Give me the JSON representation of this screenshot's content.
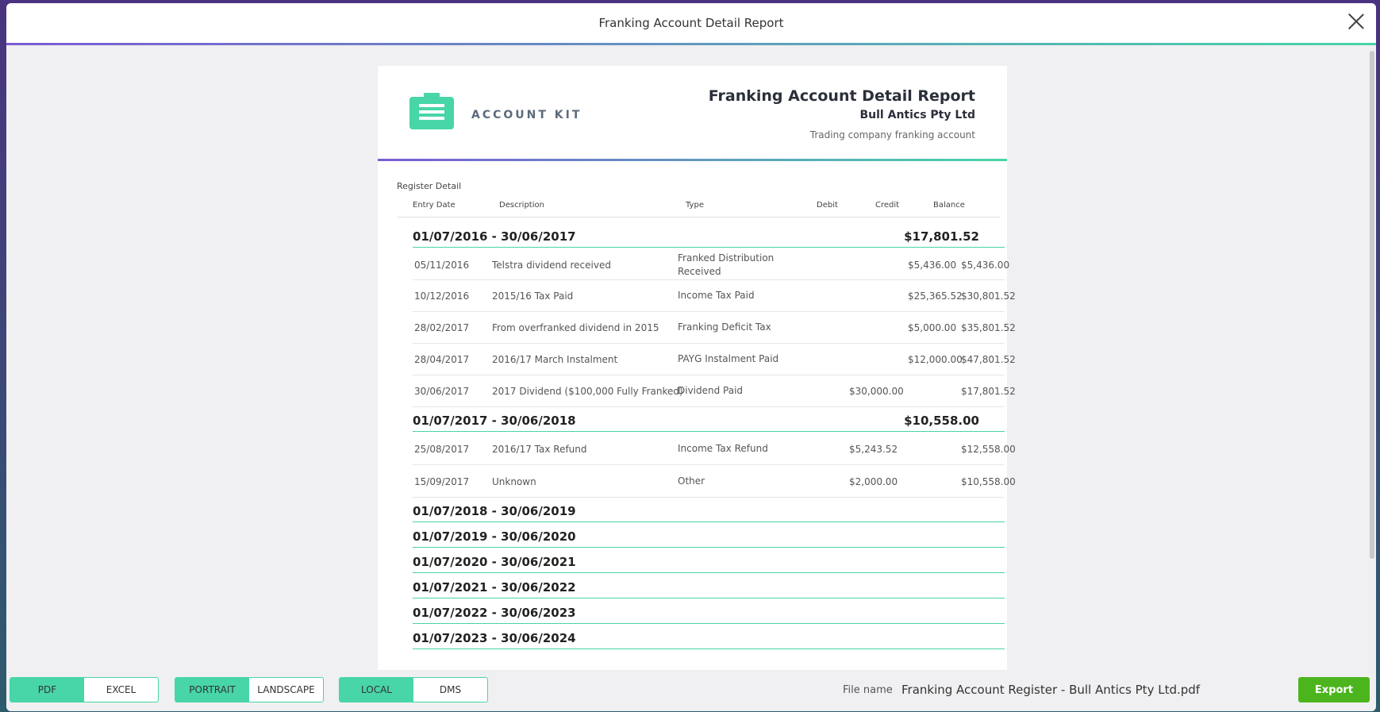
{
  "modal": {
    "title": "Franking Account Detail Report"
  },
  "report": {
    "logo_text": "ACCOUNT KIT",
    "title": "Franking Account Detail Report",
    "company": "Bull Antics Pty Ltd",
    "subtitle": "Trading company franking account",
    "section_title": "Register Detail",
    "columns": {
      "entry_date": "Entry Date",
      "description": "Description",
      "type": "Type",
      "debit": "Debit",
      "credit": "Credit",
      "balance": "Balance"
    },
    "periods": [
      {
        "label": "01/07/2016 - 30/06/2017",
        "balance": "$17,801.52",
        "rows": [
          {
            "date": "05/11/2016",
            "desc": "Telstra dividend received",
            "type": "Franked Distribution Received",
            "debit": "",
            "credit": "$5,436.00",
            "balance": "$5,436.00"
          },
          {
            "date": "10/12/2016",
            "desc": "2015/16 Tax Paid",
            "type": "Income Tax Paid",
            "debit": "",
            "credit": "$25,365.52",
            "balance": "$30,801.52"
          },
          {
            "date": "28/02/2017",
            "desc": "From overfranked dividend in 2015",
            "type": "Franking Deficit Tax",
            "debit": "",
            "credit": "$5,000.00",
            "balance": "$35,801.52"
          },
          {
            "date": "28/04/2017",
            "desc": "2016/17 March Instalment",
            "type": "PAYG Instalment Paid",
            "debit": "",
            "credit": "$12,000.00",
            "balance": "$47,801.52"
          },
          {
            "date": "30/06/2017",
            "desc": "2017 Dividend ($100,000 Fully Franked)",
            "type": "Dividend Paid",
            "debit": "$30,000.00",
            "credit": "",
            "balance": "$17,801.52"
          }
        ]
      },
      {
        "label": "01/07/2017 - 30/06/2018",
        "balance": "$10,558.00",
        "rows": [
          {
            "date": "25/08/2017",
            "desc": "2016/17 Tax Refund",
            "type": "Income Tax Refund",
            "debit": "$5,243.52",
            "credit": "",
            "balance": "$12,558.00"
          },
          {
            "date": "15/09/2017",
            "desc": "Unknown",
            "type": "Other",
            "debit": "$2,000.00",
            "credit": "",
            "balance": "$10,558.00"
          }
        ]
      },
      {
        "label": "01/07/2018 - 30/06/2019",
        "balance": "",
        "rows": []
      },
      {
        "label": "01/07/2019 - 30/06/2020",
        "balance": "",
        "rows": []
      },
      {
        "label": "01/07/2020 - 30/06/2021",
        "balance": "",
        "rows": []
      },
      {
        "label": "01/07/2021 - 30/06/2022",
        "balance": "",
        "rows": []
      },
      {
        "label": "01/07/2022 - 30/06/2023",
        "balance": "",
        "rows": []
      },
      {
        "label": "01/07/2023 - 30/06/2024",
        "balance": "",
        "rows": []
      }
    ]
  },
  "footer": {
    "format": {
      "pdf": "PDF",
      "excel": "EXCEL",
      "selected": "pdf"
    },
    "orientation": {
      "portrait": "PORTRAIT",
      "landscape": "LANDSCAPE",
      "selected": "portrait"
    },
    "destination": {
      "local": "LOCAL",
      "dms": "DMS",
      "selected": "local"
    },
    "file_name_label": "File name",
    "file_name_value": "Franking Account Register - Bull Antics Pty Ltd.pdf",
    "export_label": "Export"
  },
  "colors": {
    "accent_green": "#48d5a8",
    "accent_purple": "#7b5bd6",
    "export_green": "#4cb51e"
  },
  "icons": {
    "close": "close-icon",
    "logo": "briefcase-logo-icon"
  }
}
